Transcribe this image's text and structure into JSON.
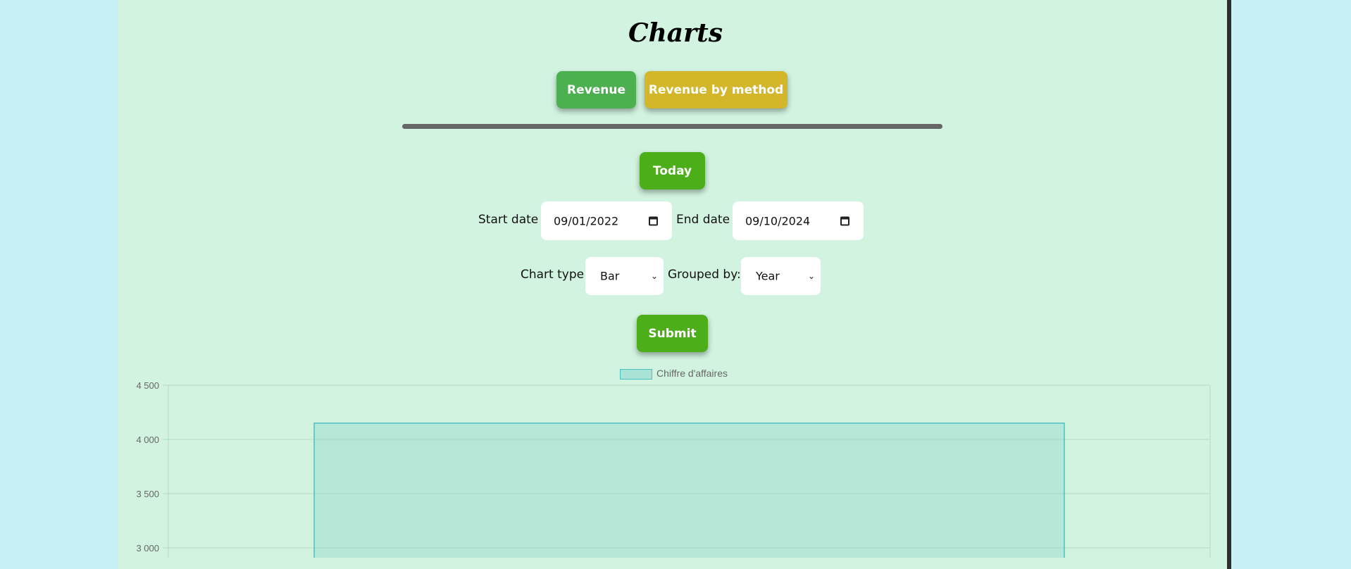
{
  "page": {
    "title": "Charts"
  },
  "tabs": {
    "revenue_label": "Revenue",
    "revenue_by_method_label": "Revenue by method"
  },
  "filters": {
    "today_label": "Today",
    "start_date_label": "Start date",
    "start_date_value": "09/01/2022",
    "end_date_label": "End date",
    "end_date_value": "09/10/2024",
    "chart_type_label": "Chart type",
    "chart_type_value": "Bar",
    "grouped_by_label": "Grouped by:",
    "grouped_by_value": "Year",
    "submit_label": "Submit"
  },
  "colors": {
    "tab_revenue": "#4caf50",
    "tab_revenue_by_method": "#d4b62a",
    "action_green": "#4caf19",
    "panel_bg": "#d1f3df",
    "page_bg": "#c8f0f5",
    "bar_fill": "rgba(75,192,192,0.2)",
    "bar_stroke": "#4bc0c0"
  },
  "chart_data": {
    "type": "bar",
    "legend": "Chiffre d'affaires",
    "legend_position": "top",
    "grid": true,
    "ylim": [
      3000,
      4500
    ],
    "y_ticks": [
      "4 500",
      "4 000",
      "3 500",
      "3 000"
    ],
    "y_tick_values": [
      4500,
      4000,
      3500,
      3000
    ],
    "series": [
      {
        "name": "Chiffre d'affaires",
        "values": [
          4150
        ]
      }
    ]
  }
}
